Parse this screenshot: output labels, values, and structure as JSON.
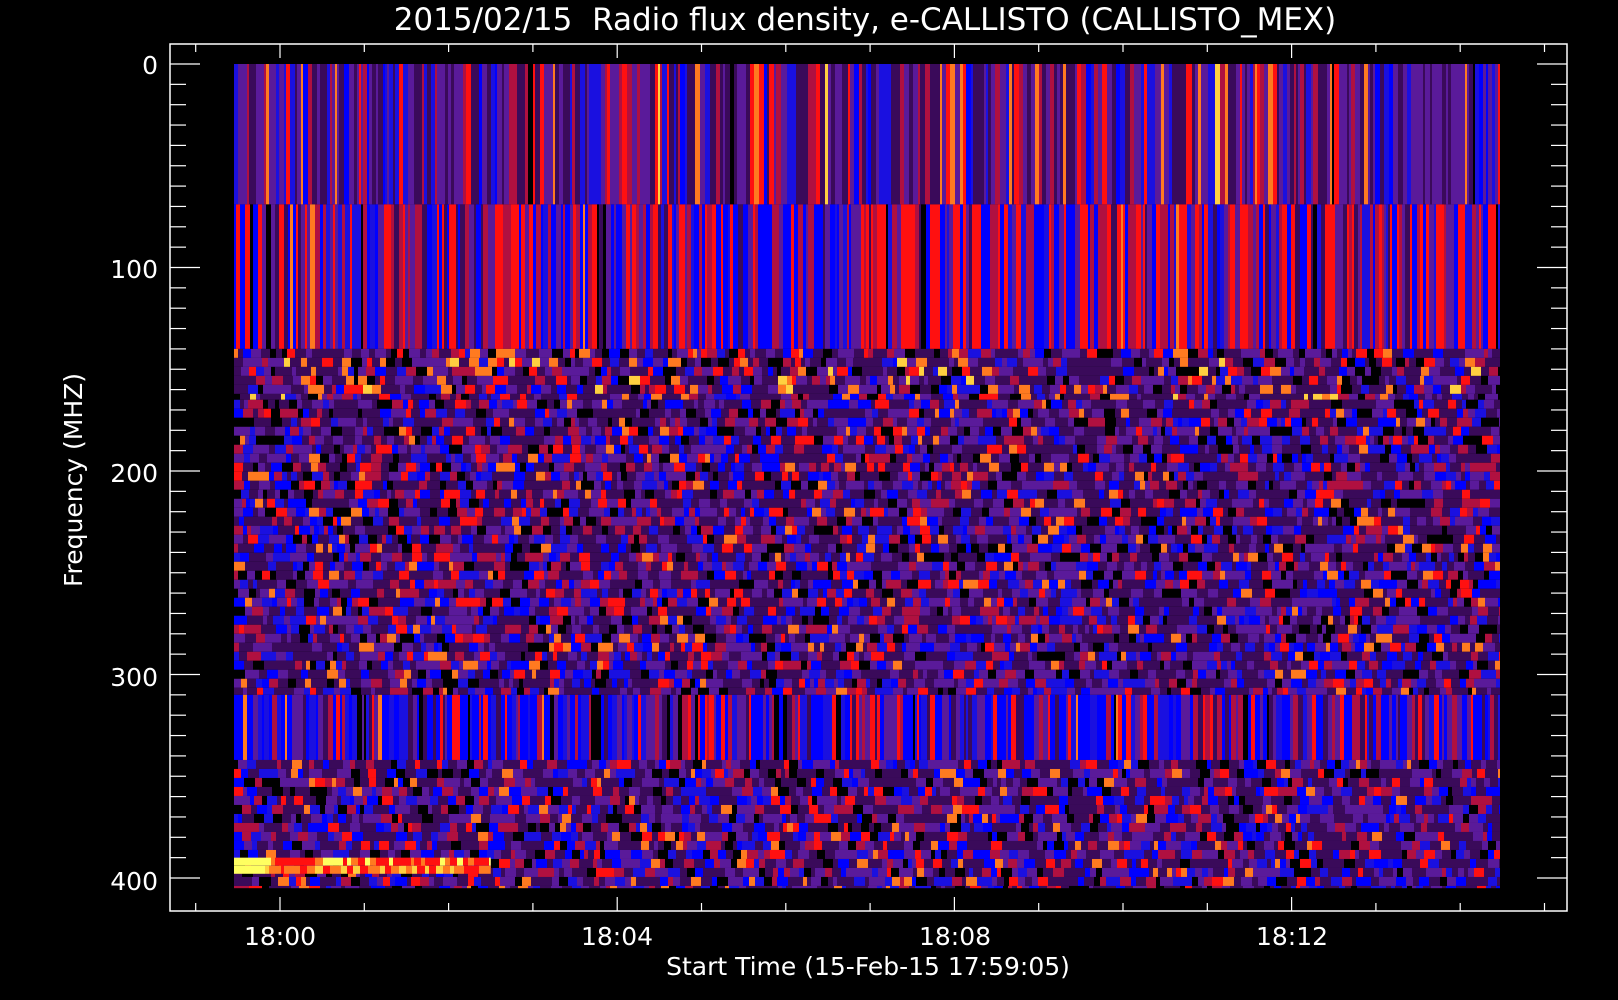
{
  "chart_data": {
    "type": "heatmap",
    "title": "2015/02/15  Radio flux density, e-CALLISTO (CALLISTO_MEX)",
    "xlabel": "Start Time (15-Feb-15 17:59:05)",
    "ylabel": "Frequency (MHZ)",
    "x_ticks": [
      "18:00",
      "18:04",
      "18:08",
      "18:12"
    ],
    "y_ticks": [
      "0",
      "100",
      "200",
      "300",
      "400"
    ],
    "x_range": [
      "17:59:05",
      "18:14:05"
    ],
    "y_range_mhz": [
      0,
      405
    ],
    "y_inverted": true,
    "background": "#000000",
    "colormap": [
      "#000000",
      "#3a0a5a",
      "#5a1a9a",
      "#1a10e0",
      "#0000ff",
      "#b01040",
      "#ff1010",
      "#ff7a20",
      "#ffd040",
      "#ffff60"
    ],
    "bands": [
      {
        "from_mhz": 0,
        "to_mhz": 69,
        "pattern": "vertical streaks",
        "dominant": "purple/violet"
      },
      {
        "from_mhz": 69,
        "to_mhz": 140,
        "pattern": "vertical streaks",
        "dominant": "red/blue"
      },
      {
        "from_mhz": 140,
        "to_mhz": 165,
        "pattern": "streaks with orange speckle",
        "dominant": "purple/orange"
      },
      {
        "from_mhz": 165,
        "to_mhz": 310,
        "pattern": "noisy fine-grain",
        "dominant": "purple/blue/red"
      },
      {
        "from_mhz": 310,
        "to_mhz": 342,
        "pattern": "vertical streaks",
        "dominant": "blue/red"
      },
      {
        "from_mhz": 342,
        "to_mhz": 405,
        "pattern": "noisy fine-grain",
        "dominant": "purple/blue"
      }
    ],
    "annotations": [
      {
        "note": "bright yellow/orange/red emission near 390-398 MHz",
        "time_range": [
          "17:59:05",
          "18:02:30"
        ]
      }
    ]
  }
}
